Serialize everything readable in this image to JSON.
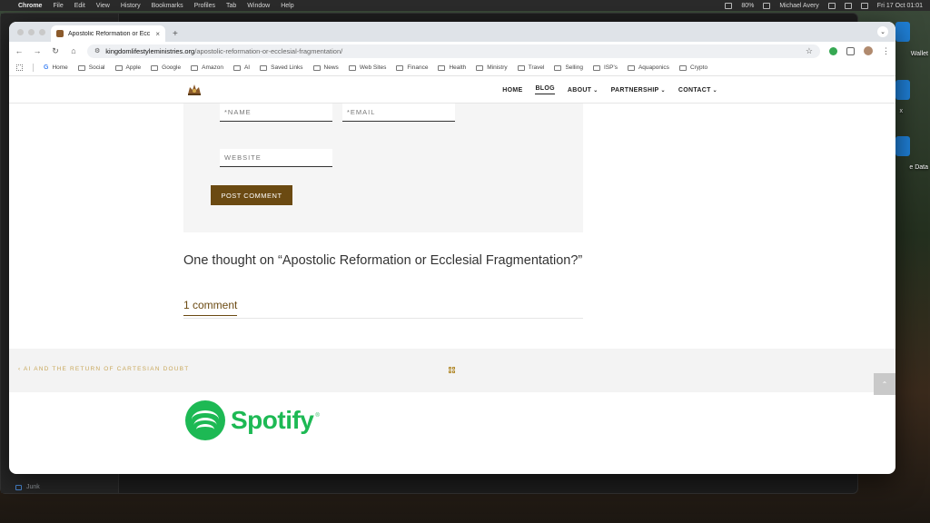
{
  "menubar": {
    "app": "Chrome",
    "items": [
      "File",
      "Edit",
      "View",
      "History",
      "Bookmarks",
      "Profiles",
      "Tab",
      "Window",
      "Help"
    ],
    "user": "Michael Avery",
    "clock": "Fri 17 Oct  01:01",
    "battery": "80%"
  },
  "desktop": {
    "labels": [
      "Wallet",
      "x",
      "e Data"
    ]
  },
  "behind_window": {
    "folder": "Junk"
  },
  "browser": {
    "tab_title": "Apostolic Reformation or Ecc",
    "url_domain": "kingdomlifestyleministries.org",
    "url_path": "/apostolic-reformation-or-ecclesial-fragmentation/",
    "bookmarks": [
      "Home",
      "Social",
      "Apple",
      "Google",
      "Amazon",
      "AI",
      "Saved Links",
      "News",
      "Web Sites",
      "Finance",
      "Health",
      "Ministry",
      "Travel",
      "Selling",
      "ISP's",
      "Aquaponics",
      "Crypto"
    ]
  },
  "site": {
    "nav": {
      "home": "HOME",
      "blog": "BLOG",
      "about": "ABOUT",
      "partnership": "PARTNERSHIP",
      "contact": "CONTACT"
    },
    "form": {
      "name_placeholder": "*NAME",
      "email_placeholder": "*EMAIL",
      "website_placeholder": "WEBSITE",
      "submit_label": "POST COMMENT"
    },
    "thought_heading": "One thought on “Apostolic Reformation or Ecclesial Fragmentation?”",
    "comment_count": "1 comment",
    "prev_post": "‹ AI AND THE RETURN OF CARTESIAN DOUBT",
    "spotify": "Spotify"
  },
  "colors": {
    "brand_brown": "#6b4a12",
    "spotify_green": "#1db954"
  }
}
